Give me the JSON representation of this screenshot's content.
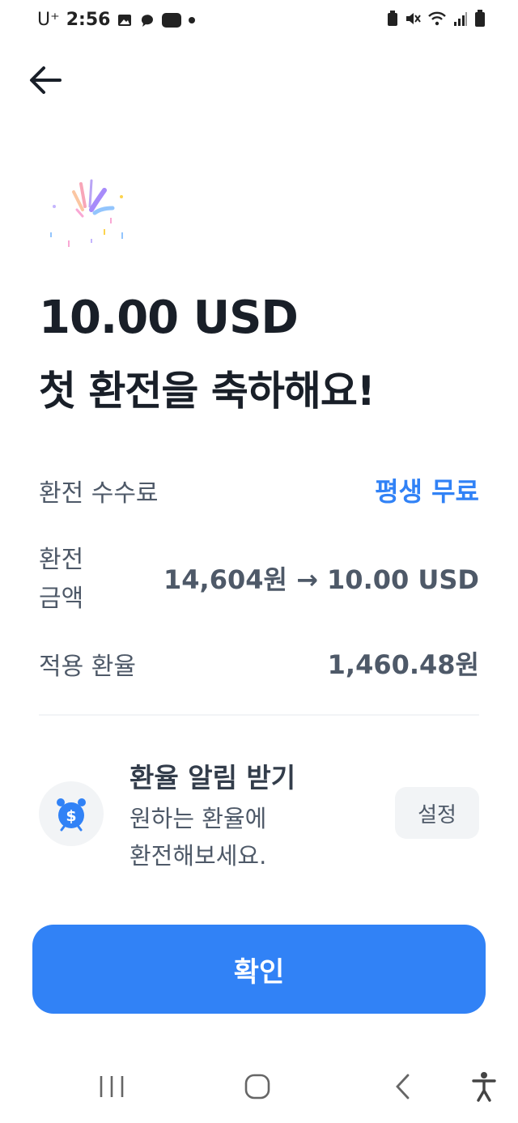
{
  "status_bar": {
    "carrier": "U⁺",
    "time": "2:56"
  },
  "hero": {
    "amount": "10.00 USD",
    "message": "첫 환전을 축하해요!"
  },
  "details": {
    "fee_label": "환전 수수료",
    "fee_value": "평생 무료",
    "amount_label_line1": "환전",
    "amount_label_line2": "금액",
    "amount_value": "14,604원 → 10.00 USD",
    "rate_label": "적용 환율",
    "rate_value": "1,460.48원"
  },
  "alert": {
    "title": "환율 알림 받기",
    "desc_line1": "원하는 환율에",
    "desc_line2": "환전해보세요.",
    "button": "설정",
    "icon": "alarm-clock-dollar-icon"
  },
  "confirm_button": "확인",
  "colors": {
    "accent": "#3182f6",
    "text_primary": "#191f28",
    "text_secondary": "#4e5968",
    "surface": "#f2f4f6"
  }
}
